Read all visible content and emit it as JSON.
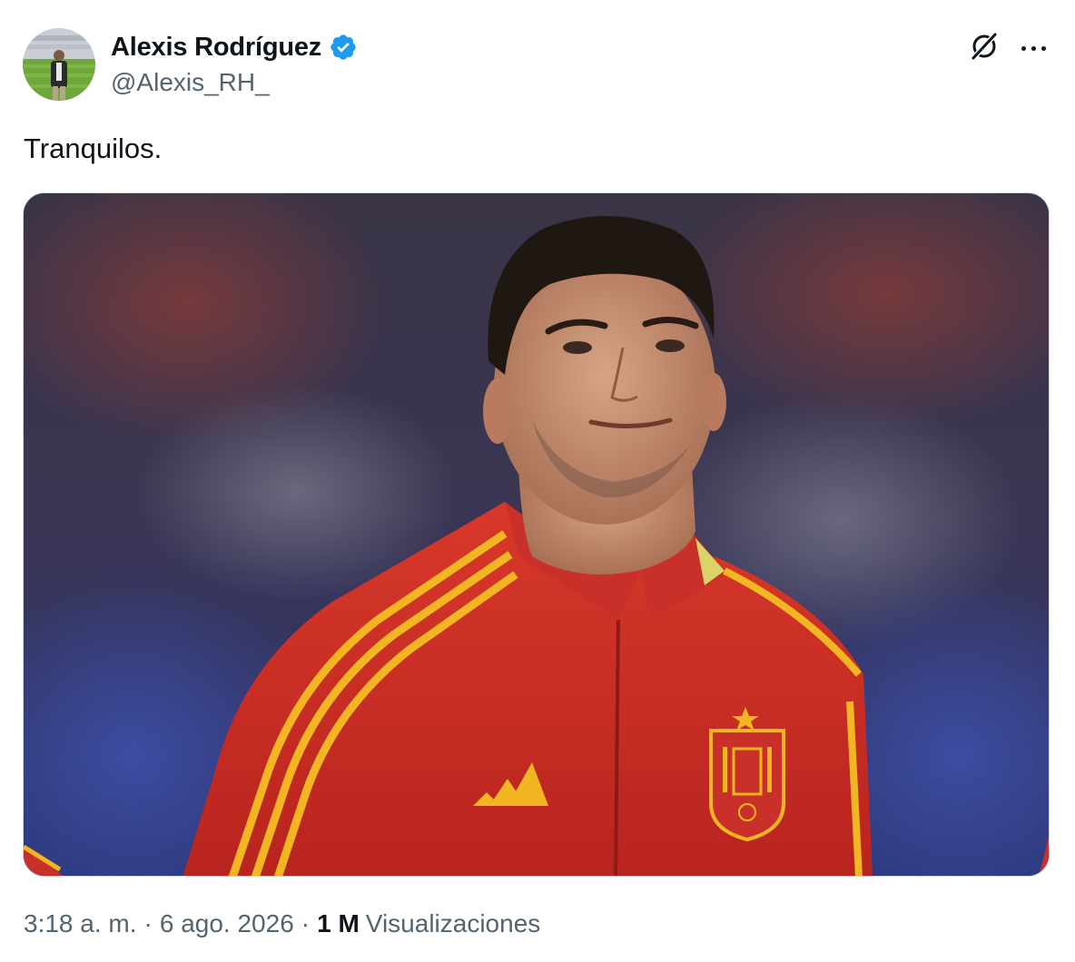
{
  "tweet": {
    "author": {
      "display_name": "Alexis Rodríguez",
      "handle": "@Alexis_RH_",
      "verified": true,
      "verified_color": "#1d9bf0"
    },
    "text": "Tranquilos.",
    "media": {
      "kind": "photo"
    },
    "meta": {
      "time": "3:18 a. m.",
      "separator": "·",
      "date": "6 ago. 2026",
      "views_count": "1 M",
      "views_label": "Visualizaciones"
    },
    "actions": {
      "grok_icon": "grok-icon",
      "more_icon": "more-horizontal-icon"
    }
  }
}
